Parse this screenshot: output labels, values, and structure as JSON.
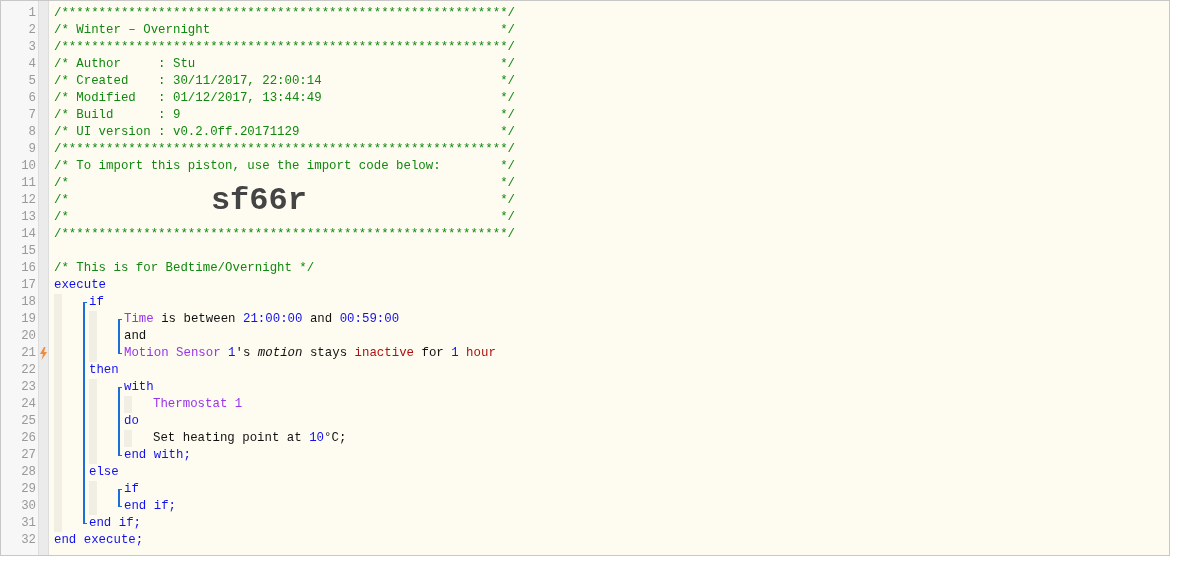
{
  "code": [
    {
      "kind": "line",
      "number": "1",
      "flash": false,
      "tokens": [
        {
          "kind": "comment",
          "text": "/************************************************************/"
        }
      ]
    },
    {
      "kind": "line",
      "number": "2",
      "flash": false,
      "tokens": [
        {
          "kind": "comment",
          "text": "/* Winter – Overnight"
        }
      ],
      "close": "*/"
    },
    {
      "kind": "line",
      "number": "3",
      "flash": false,
      "tokens": [
        {
          "kind": "comment",
          "text": "/************************************************************/"
        }
      ]
    },
    {
      "kind": "line",
      "number": "4",
      "flash": false,
      "tokens": [
        {
          "kind": "comment",
          "text": "/* Author     : Stu"
        }
      ],
      "close": "*/"
    },
    {
      "kind": "line",
      "number": "5",
      "flash": false,
      "tokens": [
        {
          "kind": "comment",
          "text": "/* Created    : 30/11/2017, 22:00:14"
        }
      ],
      "close": "*/"
    },
    {
      "kind": "line",
      "number": "6",
      "flash": false,
      "tokens": [
        {
          "kind": "comment",
          "text": "/* Modified   : 01/12/2017, 13:44:49"
        }
      ],
      "close": "*/"
    },
    {
      "kind": "line",
      "number": "7",
      "flash": false,
      "tokens": [
        {
          "kind": "comment",
          "text": "/* Build      : 9"
        }
      ],
      "close": "*/"
    },
    {
      "kind": "line",
      "number": "8",
      "flash": false,
      "tokens": [
        {
          "kind": "comment",
          "text": "/* UI version : v0.2.0ff.20171129"
        }
      ],
      "close": "*/"
    },
    {
      "kind": "line",
      "number": "9",
      "flash": false,
      "tokens": [
        {
          "kind": "comment",
          "text": "/************************************************************/"
        }
      ]
    },
    {
      "kind": "line",
      "number": "10",
      "flash": false,
      "tokens": [
        {
          "kind": "comment",
          "text": "/* To import this piston, use the import code below:"
        }
      ],
      "close": "*/"
    },
    {
      "kind": "line",
      "number": "11",
      "flash": false,
      "tokens": [
        {
          "kind": "comment",
          "text": "/*"
        }
      ],
      "close": "*/"
    },
    {
      "kind": "line",
      "number": "12",
      "flash": false,
      "tokens": [
        {
          "kind": "comment",
          "text": "/*"
        },
        {
          "kind": "import-code",
          "text": "sf66r"
        }
      ],
      "close": "*/"
    },
    {
      "kind": "line",
      "number": "13",
      "flash": false,
      "tokens": [
        {
          "kind": "comment",
          "text": "/*"
        }
      ],
      "close": "*/"
    },
    {
      "kind": "line",
      "number": "14",
      "flash": false,
      "tokens": [
        {
          "kind": "comment",
          "text": "/************************************************************/"
        }
      ]
    },
    {
      "kind": "line",
      "number": "15",
      "flash": false
    },
    {
      "kind": "line",
      "number": "16",
      "flash": false,
      "tokens": [
        {
          "kind": "comment",
          "text": "/* This is for Bedtime/Overnight */"
        }
      ]
    },
    {
      "kind": "line",
      "number": "17",
      "flash": false,
      "tokens": [
        {
          "kind": "keyword",
          "text": "execute"
        }
      ]
    },
    {
      "kind": "indent",
      "children": [
        {
          "kind": "block",
          "children": [
            {
              "kind": "line",
              "number": "18",
              "flash": false,
              "tokens": [
                {
                  "kind": "keyword",
                  "text": "if"
                }
              ]
            },
            {
              "kind": "indent",
              "children": [
                {
                  "kind": "block",
                  "children": [
                    {
                      "kind": "line",
                      "number": "19",
                      "flash": false,
                      "tokens": [
                        {
                          "kind": "device",
                          "text": "Time"
                        },
                        {
                          "kind": "plain",
                          "text": " is between "
                        },
                        {
                          "kind": "value",
                          "text": "21:00:00"
                        },
                        {
                          "kind": "plain",
                          "text": " and "
                        },
                        {
                          "kind": "value",
                          "text": "00:59:00"
                        }
                      ]
                    },
                    {
                      "kind": "line",
                      "number": "20",
                      "flash": false,
                      "tokens": [
                        {
                          "kind": "plain",
                          "text": "and"
                        }
                      ]
                    },
                    {
                      "kind": "line",
                      "number": "21",
                      "flash": true,
                      "tokens": [
                        {
                          "kind": "device",
                          "text": "Motion Sensor "
                        },
                        {
                          "kind": "value",
                          "text": "1"
                        },
                        {
                          "kind": "plain",
                          "text": "'s "
                        },
                        {
                          "kind": "attribute",
                          "text": "motion"
                        },
                        {
                          "kind": "plain",
                          "text": " stays "
                        },
                        {
                          "kind": "constant",
                          "text": "inactive"
                        },
                        {
                          "kind": "plain",
                          "text": " for "
                        },
                        {
                          "kind": "value",
                          "text": "1"
                        },
                        {
                          "kind": "constant",
                          "text": " hour"
                        }
                      ]
                    }
                  ]
                }
              ]
            },
            {
              "kind": "line",
              "number": "22",
              "flash": false,
              "tokens": [
                {
                  "kind": "keyword",
                  "text": "then"
                }
              ]
            },
            {
              "kind": "indent",
              "children": [
                {
                  "kind": "block",
                  "children": [
                    {
                      "kind": "line",
                      "number": "23",
                      "flash": false,
                      "tokens": [
                        {
                          "kind": "keyword",
                          "text": "with"
                        }
                      ]
                    },
                    {
                      "kind": "indent",
                      "children": [
                        {
                          "kind": "line",
                          "number": "24",
                          "flash": false,
                          "tokens": [
                            {
                              "kind": "device",
                              "text": "Thermostat 1"
                            }
                          ]
                        }
                      ]
                    },
                    {
                      "kind": "line",
                      "number": "25",
                      "flash": false,
                      "tokens": [
                        {
                          "kind": "keyword",
                          "text": "do"
                        }
                      ]
                    },
                    {
                      "kind": "indent",
                      "children": [
                        {
                          "kind": "line",
                          "number": "26",
                          "flash": false,
                          "tokens": [
                            {
                              "kind": "plain",
                              "text": "Set heating point at "
                            },
                            {
                              "kind": "value",
                              "text": "10"
                            },
                            {
                              "kind": "plain",
                              "text": "°C;"
                            }
                          ]
                        }
                      ]
                    },
                    {
                      "kind": "line",
                      "number": "27",
                      "flash": false,
                      "tokens": [
                        {
                          "kind": "keyword",
                          "text": "end with;"
                        }
                      ]
                    }
                  ]
                }
              ]
            },
            {
              "kind": "line",
              "number": "28",
              "flash": false,
              "tokens": [
                {
                  "kind": "keyword",
                  "text": "else"
                }
              ]
            },
            {
              "kind": "indent",
              "children": [
                {
                  "kind": "block",
                  "children": [
                    {
                      "kind": "line",
                      "number": "29",
                      "flash": false,
                      "tokens": [
                        {
                          "kind": "keyword",
                          "text": "if"
                        }
                      ]
                    },
                    {
                      "kind": "line",
                      "number": "30",
                      "flash": false,
                      "tokens": [
                        {
                          "kind": "keyword",
                          "text": "end if;"
                        }
                      ]
                    }
                  ]
                }
              ]
            },
            {
              "kind": "line",
              "number": "31",
              "flash": false,
              "tokens": [
                {
                  "kind": "keyword",
                  "text": "end if;"
                }
              ]
            }
          ]
        }
      ]
    },
    {
      "kind": "line",
      "number": "32",
      "flash": false,
      "tokens": [
        {
          "kind": "keyword",
          "text": "end execute;"
        }
      ]
    }
  ]
}
